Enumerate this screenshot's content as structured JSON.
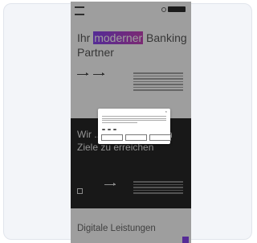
{
  "nav": {
    "links": [
      "",
      "",
      "",
      "",
      ""
    ]
  },
  "hero": {
    "title_before": "Ihr ",
    "title_highlight": "moderner",
    "title_after": " Banking Partner"
  },
  "dark": {
    "title": "Wir ... Ihre finanziellen Ziele zu erreichen"
  },
  "bottom": {
    "title": "Digitale Leistungen"
  },
  "consent": {
    "title": "",
    "link": "",
    "buttons": [
      "",
      "",
      ""
    ]
  },
  "colors": {
    "accent_start": "#7a2ff0",
    "accent_end": "#c02cb1",
    "dark_section": "#0c0c0c"
  }
}
